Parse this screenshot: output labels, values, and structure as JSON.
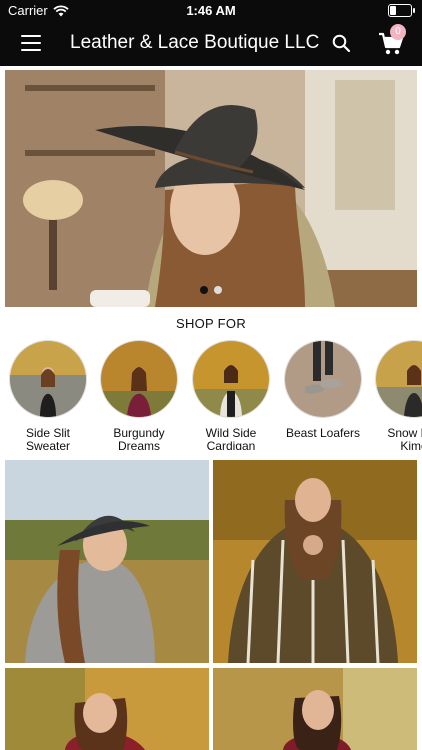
{
  "status": {
    "carrier": "Carrier",
    "time": "1:46 AM"
  },
  "header": {
    "title": "Leather & Lace Boutique LLC",
    "cart_count": "0"
  },
  "hero": {
    "slides": 2,
    "active_slide": 1
  },
  "shop_for": {
    "heading": "SHOP FOR",
    "items": [
      {
        "line1": "Side Slit",
        "line2": "Sweater"
      },
      {
        "line1": "Burgundy",
        "line2": "Dreams"
      },
      {
        "line1": "Wild Side",
        "line2": "Cardigan"
      },
      {
        "line1": "Beast Loafers",
        "line2": ""
      },
      {
        "line1": "Snow Leo",
        "line2": "Kimo"
      }
    ]
  },
  "colors": {
    "topbar": "#0b0b0b",
    "badge": "#f3b3c3",
    "accent": "#111111"
  }
}
